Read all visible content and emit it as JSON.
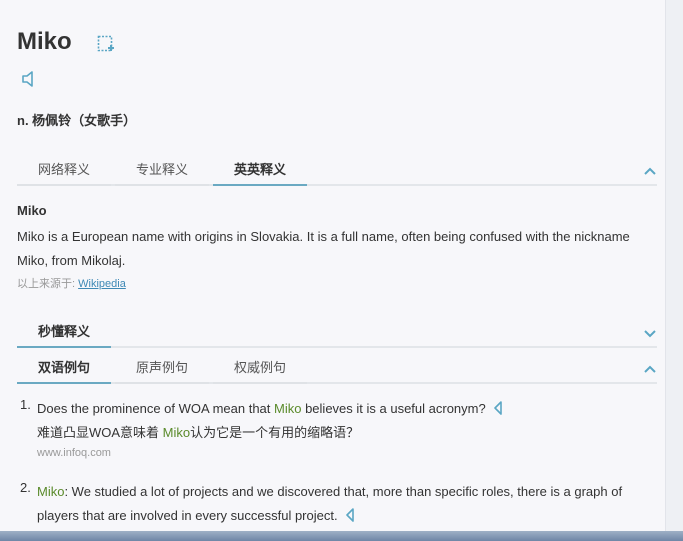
{
  "header": {
    "word": "Miko",
    "translation": "n. 杨佩铃（女歌手）"
  },
  "tabs1": [
    "网络释义",
    "专业释义",
    "英英释义"
  ],
  "definition": {
    "title": "Miko",
    "text": "Miko is a European name with origins in Slovakia. It is a full name, often being confused with the nickname Miko, from Mikolaj.",
    "source_prefix": "以上来源于: ",
    "source_link": "Wikipedia"
  },
  "tabs2": [
    "秒懂释义"
  ],
  "tabs3": [
    "双语例句",
    "原声例句",
    "权威例句"
  ],
  "examples": [
    {
      "num": "1.",
      "en_pre": "Does the prominence of WOA mean that ",
      "en_hl": "Miko",
      "en_post": " believes it is a useful acronym?",
      "zh_pre": "难道凸显WOA意味着 ",
      "zh_hl": "Miko",
      "zh_post": "认为它是一个有用的缩略语？",
      "src": "www.infoq.com"
    },
    {
      "num": "2.",
      "en_hl": "Miko",
      "en_post": ": We studied a lot of projects and we discovered that, more than specific roles, there is a graph of players that are involved in every successful project."
    }
  ],
  "colors": {
    "accent": "#6aa9c2",
    "highlight": "#5a8a2a",
    "link": "#3f89b5"
  },
  "icons": [
    "add-wordbook-icon",
    "speaker-icon",
    "chevron-up-icon",
    "chevron-down-icon"
  ]
}
